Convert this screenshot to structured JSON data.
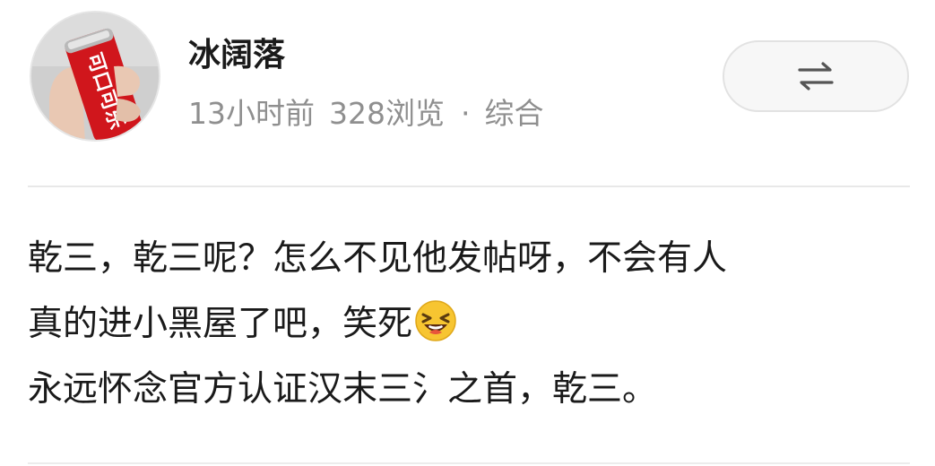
{
  "post": {
    "author": "冰阔落",
    "time": "13小时前",
    "views": "328浏览",
    "separator": "·",
    "category": "综合",
    "lines": [
      "乾三，乾三呢？怎么不见他发帖呀，不会有人",
      "真的进小黑屋了吧，笑死",
      "永远怀念官方认证汉末三氵之首，乾三。"
    ],
    "emoji": "laughing-face"
  },
  "avatar": {
    "description_icon": "cola-can-avatar",
    "can_text": "可口可乐"
  },
  "actions": {
    "swap_icon": "swap-arrows-icon"
  },
  "colors": {
    "text": "#1a1a1a",
    "meta": "#8f8f8f",
    "button_bg": "#f7f7f7",
    "button_border": "#e2e2e2",
    "divider": "#e8e8e8",
    "can_red": "#d0161c"
  }
}
